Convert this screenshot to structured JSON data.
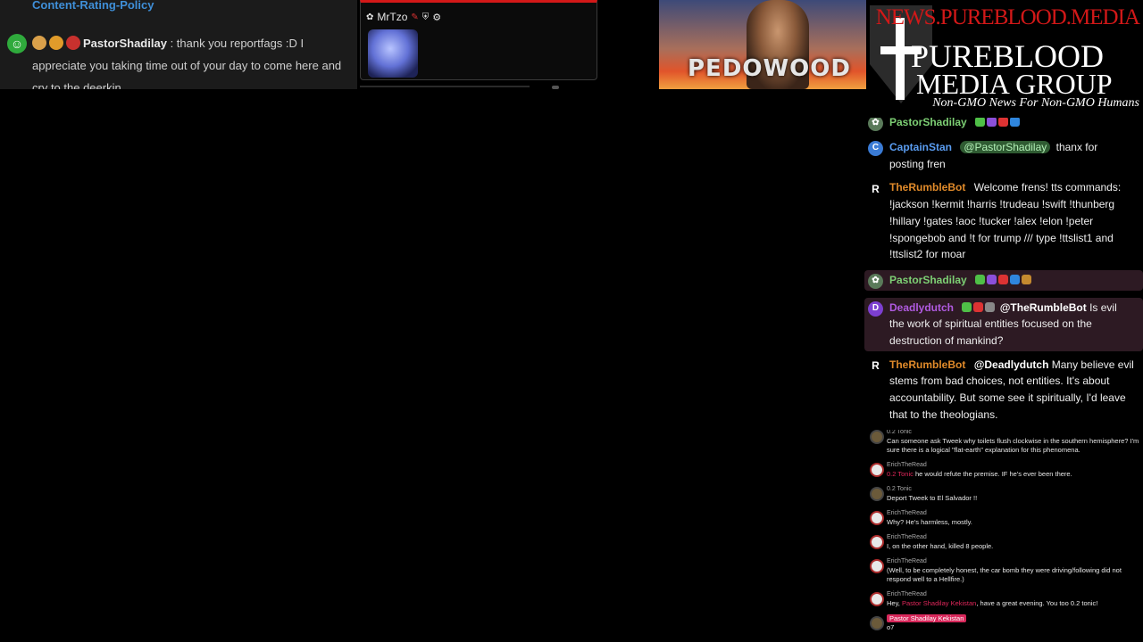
{
  "top_left": {
    "policy_link": "Content-Rating-Policy",
    "username": "PastorShadilay",
    "message": ": thank you reportfags :D I appreciate you taking time out of your day to come here and cry to the deerkin"
  },
  "card": {
    "username": "MrTzo"
  },
  "video": {
    "caption": "PEDOWOOD"
  },
  "logo": {
    "url_text": "NEWS.PUREBLOOD.MEDIA",
    "title_line1": "PUREBLOOD",
    "title_line2": "MEDIA GROUP",
    "tagline": "Non-GMO News For Non-GMO Humans"
  },
  "chat": {
    "messages": [
      {
        "user": "PastorShadilay",
        "text": "",
        "color": "#7dcf74"
      },
      {
        "user": "CaptainStan",
        "mention": "@PastorShadilay",
        "text": "thanx for posting fren",
        "color": "#5a9cf0",
        "avatar": "C"
      },
      {
        "user": "TheRumbleBot",
        "text": "Welcome frens! tts commands: !jackson !kermit !harris !trudeau !swift !thunberg !hillary !gates !aoc !tucker !alex !elon !peter !spongebob and !t for trump /// type !ttslist1 and !ttslist2 for moar",
        "color": "#e08a2a",
        "avatar": "R"
      },
      {
        "user": "PastorShadilay",
        "text": "",
        "color": "#7dcf74"
      },
      {
        "user": "Deadlydutch",
        "bold": "@TheRumbleBot",
        "text": "Is evil the work of spiritual entities focused on the destruction of mankind?",
        "color": "#b05ae0",
        "avatar": "D"
      },
      {
        "user": "TheRumbleBot",
        "bold": "@Deadlydutch",
        "text": "Many believe evil stems from bad choices, not entities. It's about accountability. But some see it spiritually, I'd leave that to the theologians.",
        "color": "#e08a2a",
        "avatar": "R"
      }
    ]
  },
  "mini_chat": {
    "rows": [
      {
        "name": "0.2 Tonic",
        "text": "Can someone ask Tweek why toilets flush clockwise in the southern hemisphere? I'm sure there is a logical \"flat-earth\" explanation for this phenomena."
      },
      {
        "name": "ErichTheRead",
        "prefix": "0.2 Tonic",
        "text": "he would refute the premise. IF he's ever been there."
      },
      {
        "name": "0.2 Tonic",
        "text": "Deport Tweek to El Salvador !!"
      },
      {
        "name": "ErichTheRead",
        "text": "Why? He's harmless, mostly."
      },
      {
        "name": "ErichTheRead",
        "text": "I, on the other hand, killed 8 people."
      },
      {
        "name": "ErichTheRead",
        "text": "(Well, to be completely honest, the car bomb they were driving/following did not respond well to a Hellfire.)"
      },
      {
        "name": "ErichTheRead",
        "prefix": "Pastor Shadilay Kekistan",
        "pre_text": "Hey,",
        "text": ", have a great evening. You too 0.2 tonic!"
      },
      {
        "name": "Pastor Shadilay Kekistan",
        "text": "o7",
        "highlight_name": true
      }
    ]
  }
}
